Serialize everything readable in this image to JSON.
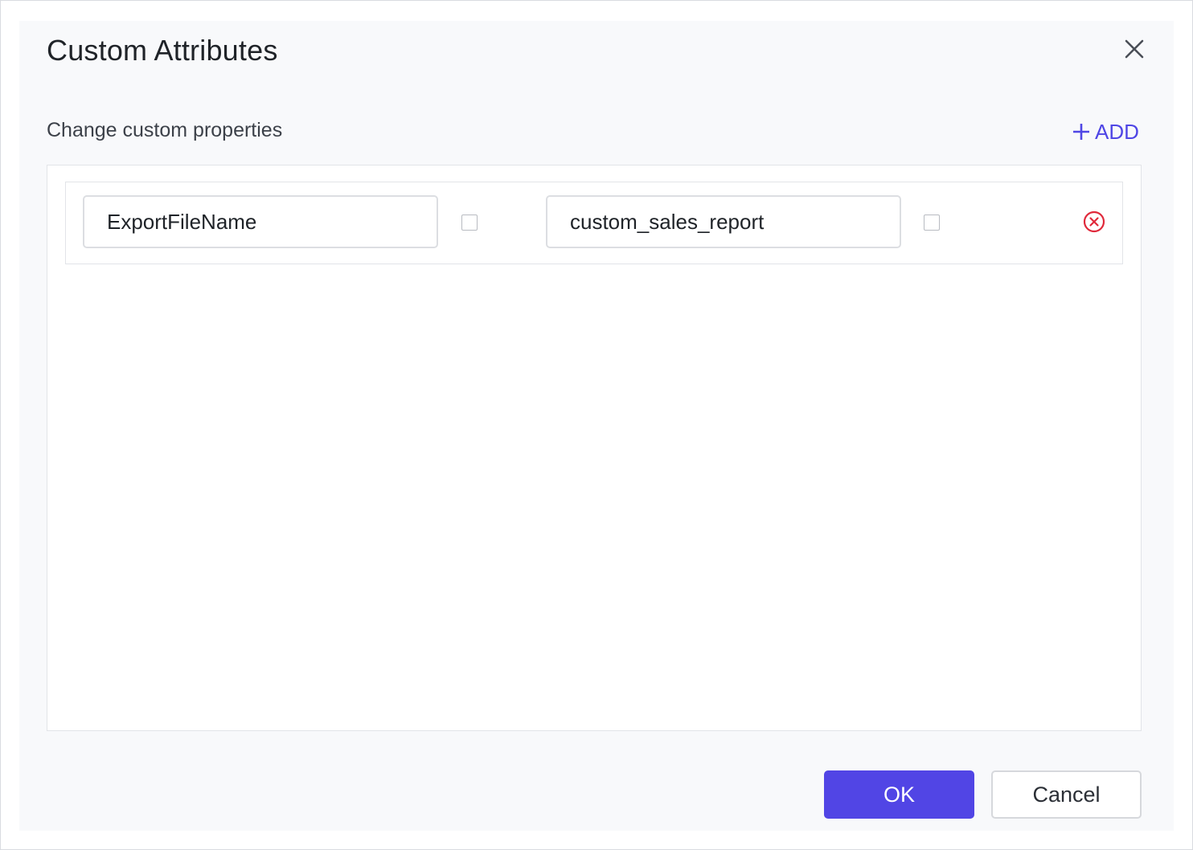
{
  "dialog": {
    "title": "Custom Attributes",
    "close_icon": "close-icon"
  },
  "section": {
    "label": "Change custom properties",
    "add_label": "ADD",
    "add_icon": "plus-icon"
  },
  "properties": [
    {
      "key": "ExportFileName",
      "key_checked": false,
      "value": "custom_sales_report",
      "value_checked": false,
      "remove_icon": "remove-circle-icon"
    }
  ],
  "footer": {
    "ok_label": "OK",
    "cancel_label": "Cancel"
  },
  "colors": {
    "accent": "#5145e5",
    "add_link": "#4f46e5",
    "remove": "#e0293b",
    "dialog_bg": "#f8f9fb"
  }
}
